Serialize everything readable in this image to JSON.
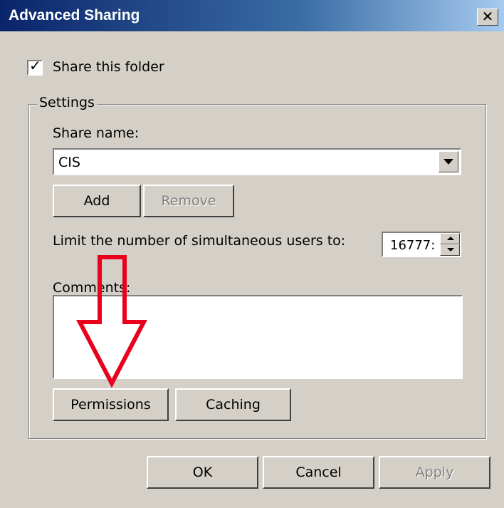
{
  "window": {
    "title": "Advanced Sharing",
    "close_glyph": "✕"
  },
  "share_checkbox": {
    "label": "Share this folder",
    "checked": true
  },
  "settings": {
    "group_title": "Settings",
    "share_name_label": "Share name:",
    "share_name_value": "CIS",
    "add_label": "Add",
    "remove_label": "Remove",
    "limit_label": "Limit the number of simultaneous users to:",
    "limit_value": "16777:",
    "comments_label": "Comments:",
    "comments_value": "",
    "permissions_label": "Permissions",
    "caching_label": "Caching"
  },
  "footer": {
    "ok_label": "OK",
    "cancel_label": "Cancel",
    "apply_label": "Apply"
  },
  "annotation": {
    "type": "arrow",
    "direction": "down",
    "color": "#e8001c",
    "points_to": "permissions-button"
  },
  "colors": {
    "dialog_bg": "#d4d0c8",
    "titlebar": "#0a246a",
    "arrow": "#e8001c"
  },
  "icons": {
    "checkbox": "check-icon",
    "combo": "chevron-down-icon",
    "spin_up": "arrow-up-icon",
    "spin_down": "arrow-down-icon",
    "close": "close-icon"
  }
}
